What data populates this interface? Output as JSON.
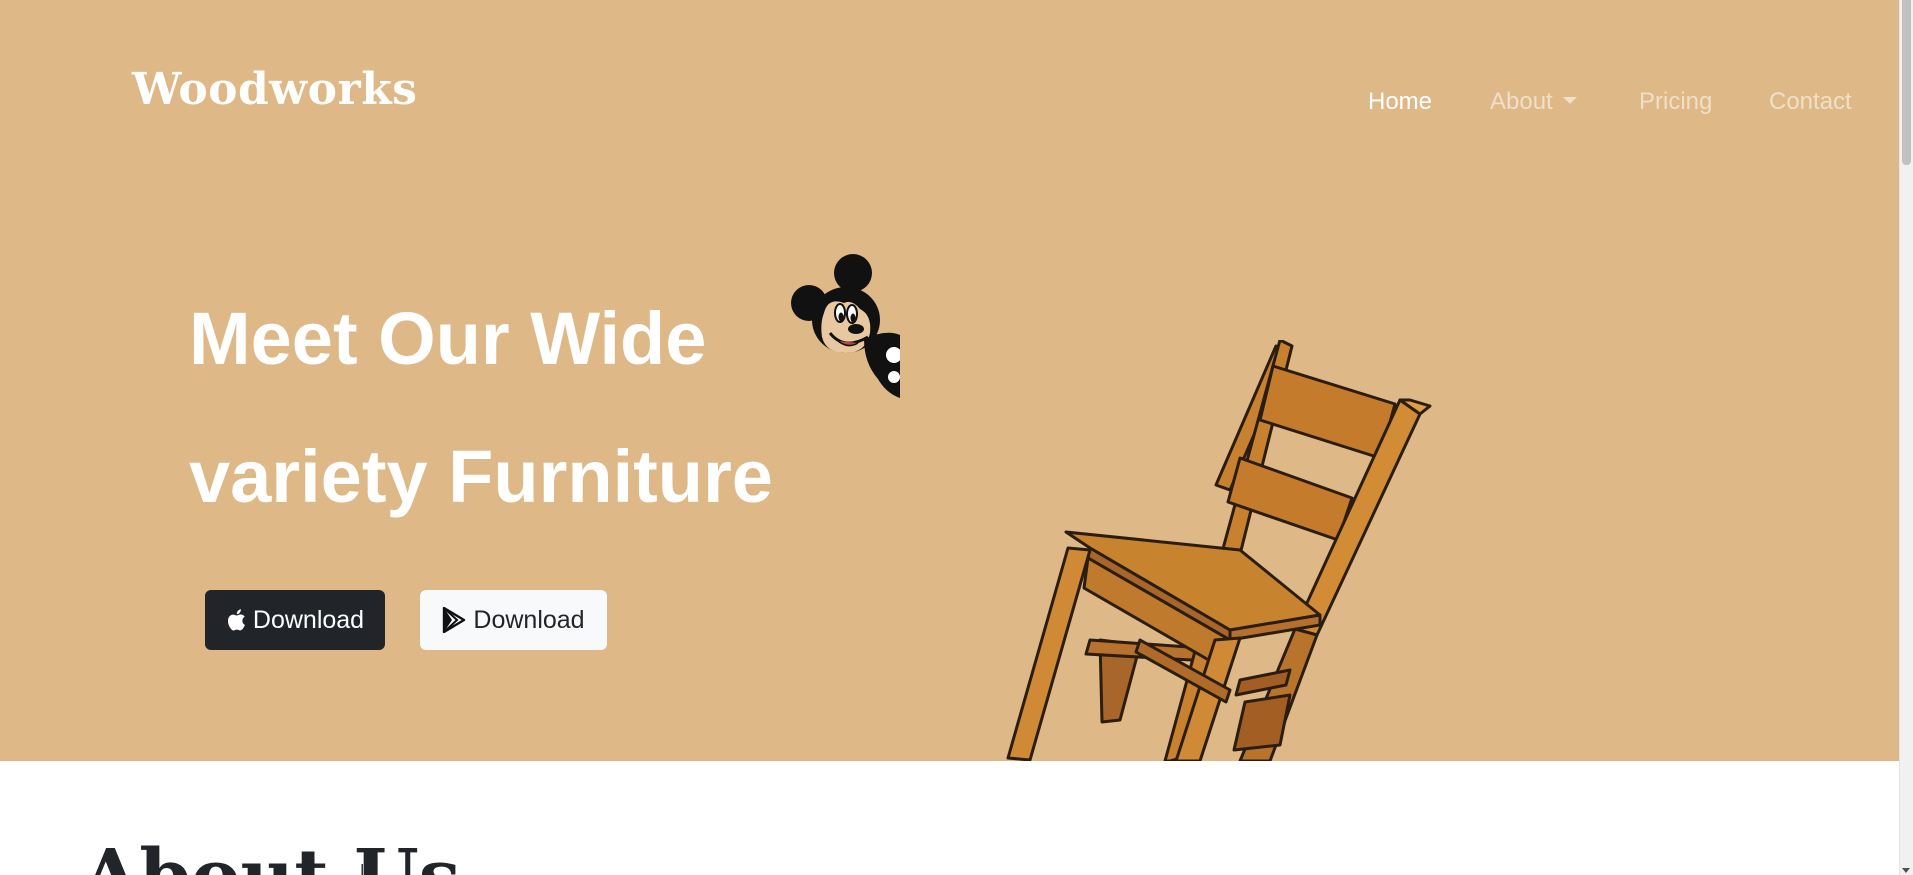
{
  "header": {
    "brand": "Woodworks",
    "nav": [
      {
        "label": "Home",
        "active": true
      },
      {
        "label": "About",
        "has_dropdown": true
      },
      {
        "label": "Pricing"
      },
      {
        "label": "Contact"
      }
    ]
  },
  "hero": {
    "headline_line1": "Meet Our Wide",
    "headline_line2": "variety Furniture",
    "background_color": "#deb887",
    "buttons": [
      {
        "label": "Download",
        "icon": "apple-icon",
        "style": "dark"
      },
      {
        "label": "Download",
        "icon": "google-play-icon",
        "style": "light"
      }
    ],
    "images": [
      "mickey-mouse-image",
      "wooden-chair-image"
    ]
  },
  "about": {
    "heading": "About Us"
  },
  "colors": {
    "hero_bg": "#deb887",
    "dark_button": "#212529",
    "light_button": "#f8f9fa",
    "nav_inactive": "rgba(255,255,255,0.55)"
  }
}
